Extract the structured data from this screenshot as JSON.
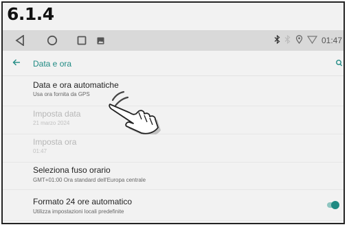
{
  "section_number": "6.1.4",
  "statusbar": {
    "time": "01:47",
    "icons": [
      "back-triangle-icon",
      "home-circle-icon",
      "recents-square-icon",
      "image-icon",
      "bluetooth-icon",
      "signal-icon",
      "location-icon",
      "wifi-icon"
    ]
  },
  "appbar": {
    "title": "Data e ora",
    "back_icon": "arrow-left-icon",
    "search_icon": "search-icon"
  },
  "settings": [
    {
      "title": "Data e ora automatiche",
      "subtitle": "Usa ora fornita da GPS",
      "enabled": true
    },
    {
      "title": "Imposta data",
      "subtitle": "21 marzo 2024",
      "enabled": false
    },
    {
      "title": "Imposta ora",
      "subtitle": "01:47",
      "enabled": false
    },
    {
      "title": "Seleziona fuso orario",
      "subtitle": "GMT+01:00 Ora standard dell'Europa centrale",
      "enabled": true
    },
    {
      "title": "Formato 24 ore automatico",
      "subtitle": "Utilizza impostazioni locali predefinite",
      "enabled": true,
      "toggle_on": true
    }
  ],
  "colors": {
    "accent": "#1f8a83",
    "statusbar_bg": "#d9d9d9",
    "page_bg": "#f2f2f2"
  }
}
